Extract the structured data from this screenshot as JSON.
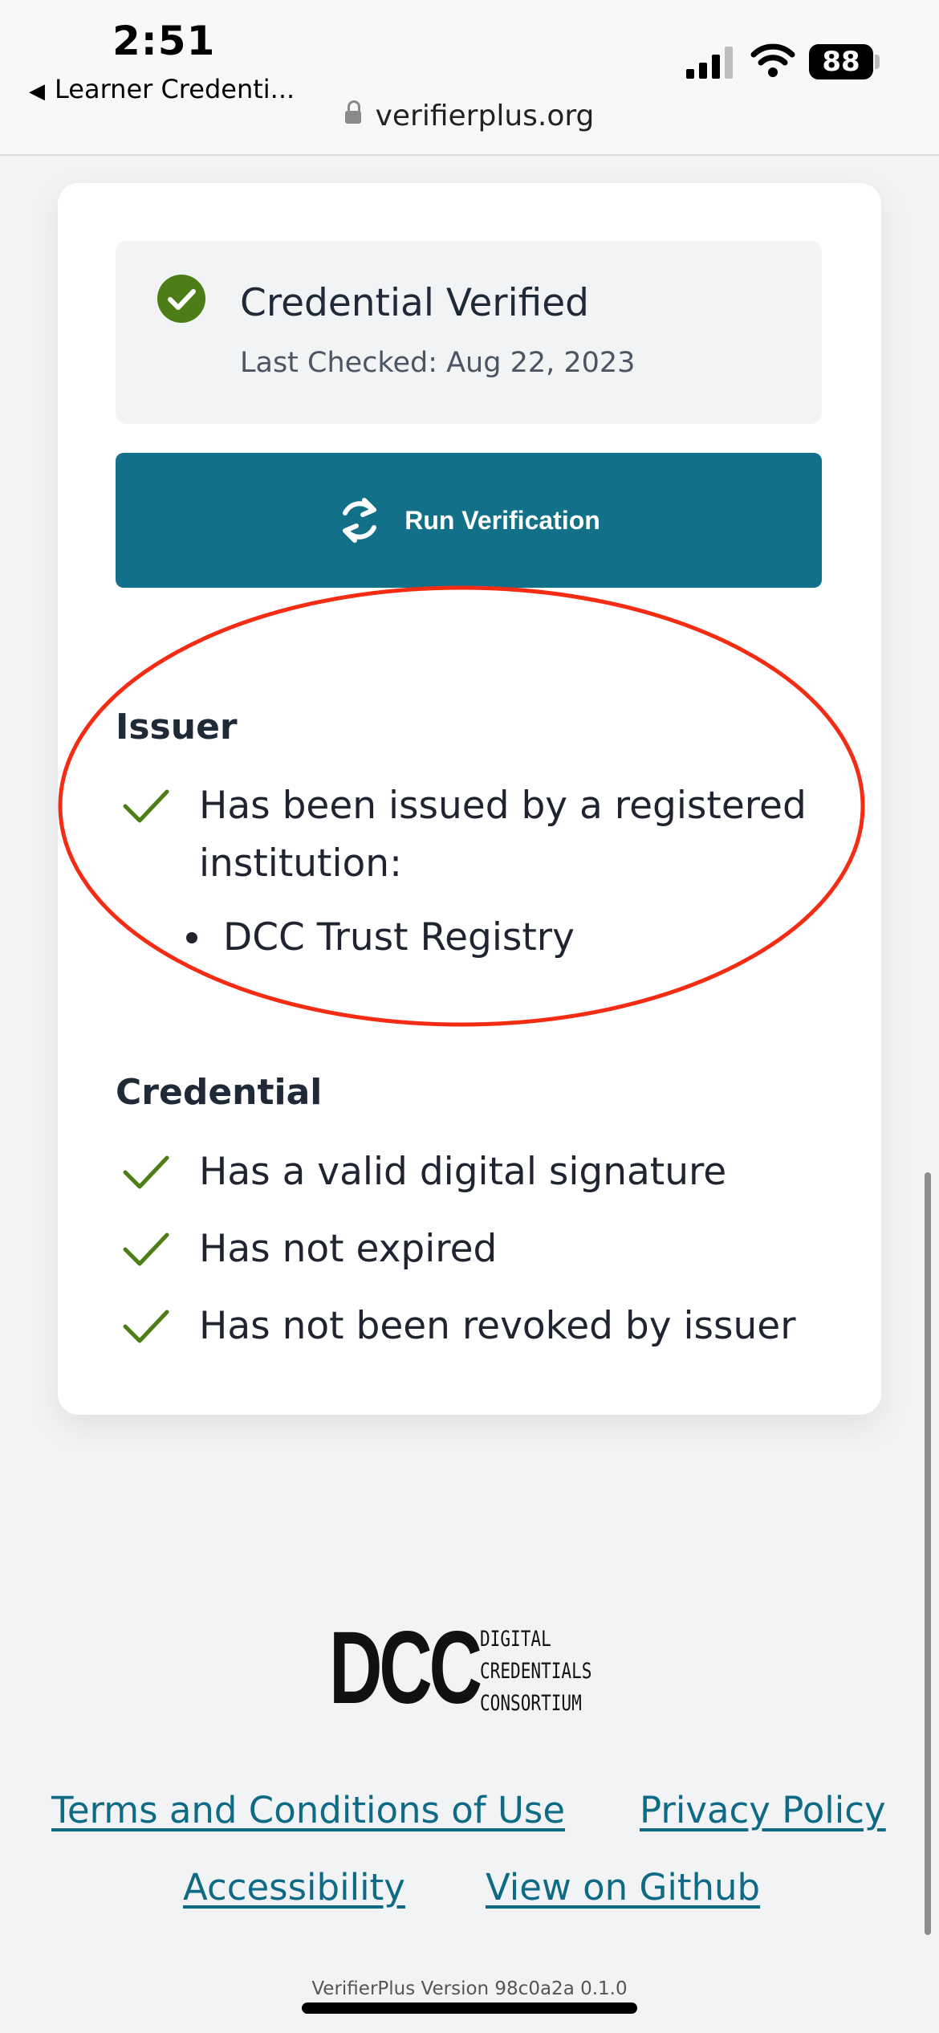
{
  "status_bar": {
    "time": "2:51",
    "back_label": "Learner Credenti...",
    "battery": "88",
    "url": "verifierplus.org"
  },
  "verification": {
    "status_title": "Credential Verified",
    "last_checked": "Last Checked: Aug 22, 2023",
    "run_button_label": "Run Verification"
  },
  "issuer": {
    "title": "Issuer",
    "check": "Has been issued by a registered",
    "check_cont": "institution:",
    "registries": [
      "DCC Trust Registry"
    ]
  },
  "credential": {
    "title": "Credential",
    "checks": [
      "Has a valid digital signature",
      "Has not expired",
      "Has not been revoked by issuer"
    ]
  },
  "footer": {
    "logo_mark": "DCC",
    "logo_words": [
      "DIGITAL",
      "CREDENTIALS",
      "CONSORTIUM"
    ],
    "links": {
      "terms": "Terms and Conditions of Use",
      "privacy": "Privacy Policy",
      "accessibility": "Accessibility",
      "github": "View on Github"
    },
    "version": "VerifierPlus Version 98c0a2a 0.1.0"
  },
  "colors": {
    "accent": "#137089",
    "check_green": "#4d7d16",
    "annotation_red": "#f42c14",
    "link": "#0f6a86"
  }
}
